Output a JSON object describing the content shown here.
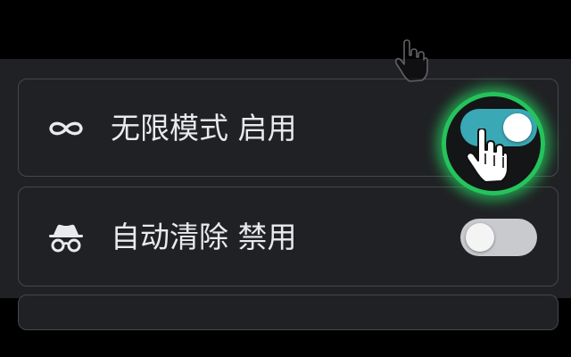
{
  "settings": {
    "rows": [
      {
        "icon": "infinity-icon",
        "label": "无限模式 启用",
        "enabled": true
      },
      {
        "icon": "incognito-icon",
        "label": "自动清除 禁用",
        "enabled": false
      }
    ]
  },
  "colors": {
    "page_background": "#000000",
    "panel_background": "#202124",
    "card_border": "#45474b",
    "text": "#e8eaed",
    "toggle_on": "#3aa8b5",
    "toggle_off": "#c8cacd",
    "highlight_ring": "#25c35c"
  },
  "overlay": {
    "highlight": "spotlight-ring",
    "cursor_icon": "hand-pointer-icon"
  }
}
